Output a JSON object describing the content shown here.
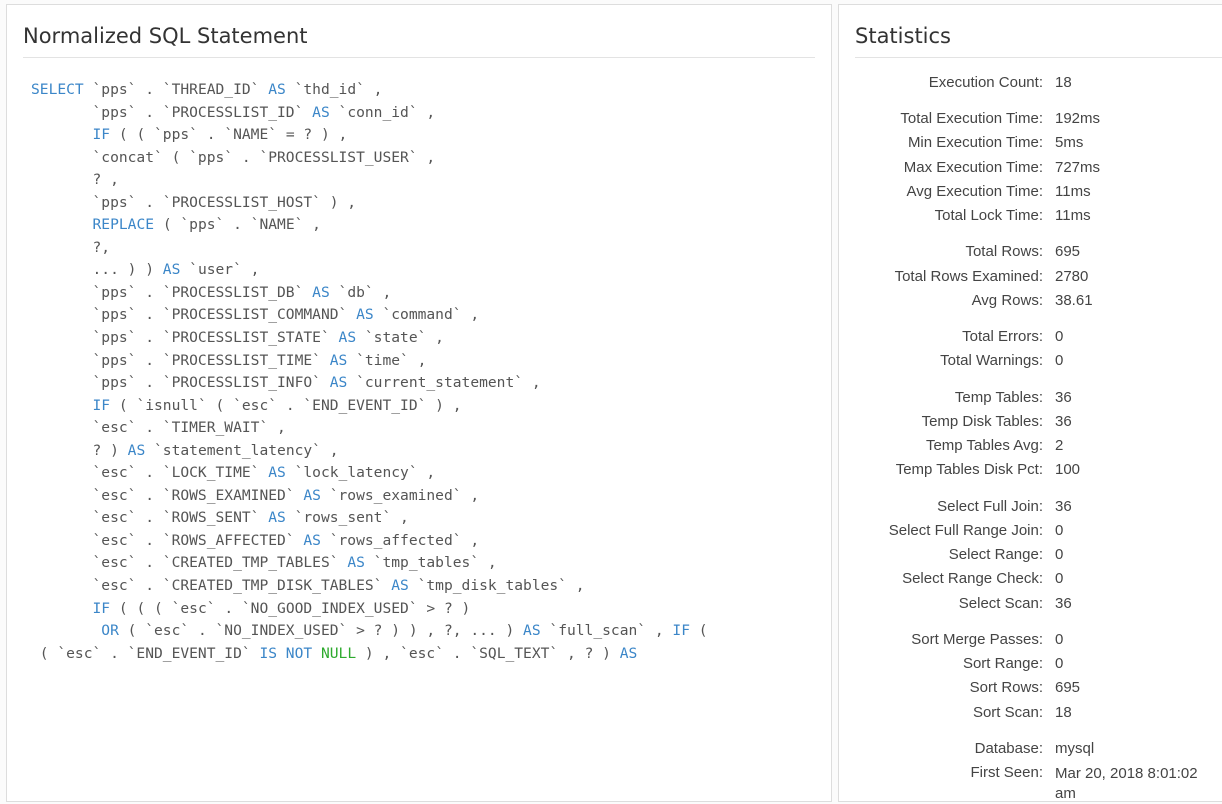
{
  "sql_panel": {
    "title": "Normalized SQL Statement",
    "lines": [
      [
        {
          "t": "SELECT",
          "c": "kw"
        },
        {
          "t": " `pps` . `THREAD_ID` ",
          "c": "id"
        },
        {
          "t": "AS",
          "c": "kw"
        },
        {
          "t": " `thd_id` ,",
          "c": "id"
        }
      ],
      [
        {
          "t": "       `pps` . `PROCESSLIST_ID` ",
          "c": "id"
        },
        {
          "t": "AS",
          "c": "kw"
        },
        {
          "t": " `conn_id` ,",
          "c": "id"
        }
      ],
      [
        {
          "t": "       ",
          "c": "id"
        },
        {
          "t": "IF",
          "c": "kw"
        },
        {
          "t": " ( ( `pps` . `NAME` = ? ) ,",
          "c": "id"
        }
      ],
      [
        {
          "t": "       `concat` ( `pps` . `PROCESSLIST_USER` ,",
          "c": "id"
        }
      ],
      [
        {
          "t": "       ? ,",
          "c": "id"
        }
      ],
      [
        {
          "t": "       `pps` . `PROCESSLIST_HOST` ) ,",
          "c": "id"
        }
      ],
      [
        {
          "t": "       ",
          "c": "id"
        },
        {
          "t": "REPLACE",
          "c": "kw"
        },
        {
          "t": " ( `pps` . `NAME` ,",
          "c": "id"
        }
      ],
      [
        {
          "t": "       ?,",
          "c": "id"
        }
      ],
      [
        {
          "t": "       ... ) ) ",
          "c": "id"
        },
        {
          "t": "AS",
          "c": "kw"
        },
        {
          "t": " `user` ,",
          "c": "id"
        }
      ],
      [
        {
          "t": "       `pps` . `PROCESSLIST_DB` ",
          "c": "id"
        },
        {
          "t": "AS",
          "c": "kw"
        },
        {
          "t": " `db` ,",
          "c": "id"
        }
      ],
      [
        {
          "t": "       `pps` . `PROCESSLIST_COMMAND` ",
          "c": "id"
        },
        {
          "t": "AS",
          "c": "kw"
        },
        {
          "t": " `command` ,",
          "c": "id"
        }
      ],
      [
        {
          "t": "       `pps` . `PROCESSLIST_STATE` ",
          "c": "id"
        },
        {
          "t": "AS",
          "c": "kw"
        },
        {
          "t": " `state` ,",
          "c": "id"
        }
      ],
      [
        {
          "t": "       `pps` . `PROCESSLIST_TIME` ",
          "c": "id"
        },
        {
          "t": "AS",
          "c": "kw"
        },
        {
          "t": " `time` ,",
          "c": "id"
        }
      ],
      [
        {
          "t": "       `pps` . `PROCESSLIST_INFO` ",
          "c": "id"
        },
        {
          "t": "AS",
          "c": "kw"
        },
        {
          "t": " `current_statement` ,",
          "c": "id"
        }
      ],
      [
        {
          "t": "       ",
          "c": "id"
        },
        {
          "t": "IF",
          "c": "kw"
        },
        {
          "t": " ( `isnull` ( `esc` . `END_EVENT_ID` ) ,",
          "c": "id"
        }
      ],
      [
        {
          "t": "       `esc` . `TIMER_WAIT` ,",
          "c": "id"
        }
      ],
      [
        {
          "t": "       ? ) ",
          "c": "id"
        },
        {
          "t": "AS",
          "c": "kw"
        },
        {
          "t": " `statement_latency` ,",
          "c": "id"
        }
      ],
      [
        {
          "t": "       `esc` . `LOCK_TIME` ",
          "c": "id"
        },
        {
          "t": "AS",
          "c": "kw"
        },
        {
          "t": " `lock_latency` ,",
          "c": "id"
        }
      ],
      [
        {
          "t": "       `esc` . `ROWS_EXAMINED` ",
          "c": "id"
        },
        {
          "t": "AS",
          "c": "kw"
        },
        {
          "t": " `rows_examined` ,",
          "c": "id"
        }
      ],
      [
        {
          "t": "       `esc` . `ROWS_SENT` ",
          "c": "id"
        },
        {
          "t": "AS",
          "c": "kw"
        },
        {
          "t": " `rows_sent` ,",
          "c": "id"
        }
      ],
      [
        {
          "t": "       `esc` . `ROWS_AFFECTED` ",
          "c": "id"
        },
        {
          "t": "AS",
          "c": "kw"
        },
        {
          "t": " `rows_affected` ,",
          "c": "id"
        }
      ],
      [
        {
          "t": "       `esc` . `CREATED_TMP_TABLES` ",
          "c": "id"
        },
        {
          "t": "AS",
          "c": "kw"
        },
        {
          "t": " `tmp_tables` ,",
          "c": "id"
        }
      ],
      [
        {
          "t": "       `esc` . `CREATED_TMP_DISK_TABLES` ",
          "c": "id"
        },
        {
          "t": "AS",
          "c": "kw"
        },
        {
          "t": " `tmp_disk_tables` ,",
          "c": "id"
        }
      ],
      [
        {
          "t": "       ",
          "c": "id"
        },
        {
          "t": "IF",
          "c": "kw"
        },
        {
          "t": " ( ( ( `esc` . `NO_GOOD_INDEX_USED` > ? )",
          "c": "id"
        }
      ],
      [
        {
          "t": "        ",
          "c": "id"
        },
        {
          "t": "OR",
          "c": "kw"
        },
        {
          "t": " ( `esc` . `NO_INDEX_USED` > ? ) ) , ?, ... ) ",
          "c": "id"
        },
        {
          "t": "AS",
          "c": "kw"
        },
        {
          "t": " `full_scan` , ",
          "c": "id"
        },
        {
          "t": "IF",
          "c": "kw"
        },
        {
          "t": " (",
          "c": "id"
        }
      ],
      [
        {
          "t": " ( `esc` . `END_EVENT_ID` ",
          "c": "id"
        },
        {
          "t": "IS NOT",
          "c": "kw"
        },
        {
          "t": " ",
          "c": "id"
        },
        {
          "t": "NULL",
          "c": "lit"
        },
        {
          "t": " ) , `esc` . `SQL_TEXT` , ? ) ",
          "c": "id"
        },
        {
          "t": "AS",
          "c": "kw"
        }
      ]
    ]
  },
  "stats_panel": {
    "title": "Statistics",
    "groups": [
      [
        {
          "label": "Execution Count:",
          "value": "18"
        }
      ],
      [
        {
          "label": "Total Execution Time:",
          "value": "192ms"
        },
        {
          "label": "Min Execution Time:",
          "value": "5ms"
        },
        {
          "label": "Max Execution Time:",
          "value": "727ms"
        },
        {
          "label": "Avg Execution Time:",
          "value": "11ms"
        },
        {
          "label": "Total Lock Time:",
          "value": "11ms"
        }
      ],
      [
        {
          "label": "Total Rows:",
          "value": "695"
        },
        {
          "label": "Total Rows Examined:",
          "value": "2780"
        },
        {
          "label": "Avg Rows:",
          "value": "38.61"
        }
      ],
      [
        {
          "label": "Total Errors:",
          "value": "0"
        },
        {
          "label": "Total Warnings:",
          "value": "0"
        }
      ],
      [
        {
          "label": "Temp Tables:",
          "value": "36"
        },
        {
          "label": "Temp Disk Tables:",
          "value": "36"
        },
        {
          "label": "Temp Tables Avg:",
          "value": "2"
        },
        {
          "label": "Temp Tables Disk Pct:",
          "value": "100"
        }
      ],
      [
        {
          "label": "Select Full Join:",
          "value": "36"
        },
        {
          "label": "Select Full Range Join:",
          "value": "0"
        },
        {
          "label": "Select Range:",
          "value": "0"
        },
        {
          "label": "Select Range Check:",
          "value": "0"
        },
        {
          "label": "Select Scan:",
          "value": "36"
        }
      ],
      [
        {
          "label": "Sort Merge Passes:",
          "value": "0"
        },
        {
          "label": "Sort Range:",
          "value": "0"
        },
        {
          "label": "Sort Rows:",
          "value": "695"
        },
        {
          "label": "Sort Scan:",
          "value": "18"
        }
      ],
      [
        {
          "label": "Database:",
          "value": "mysql"
        },
        {
          "label": "First Seen:",
          "value": "Mar 20, 2018 8:01:02 am"
        }
      ]
    ]
  }
}
